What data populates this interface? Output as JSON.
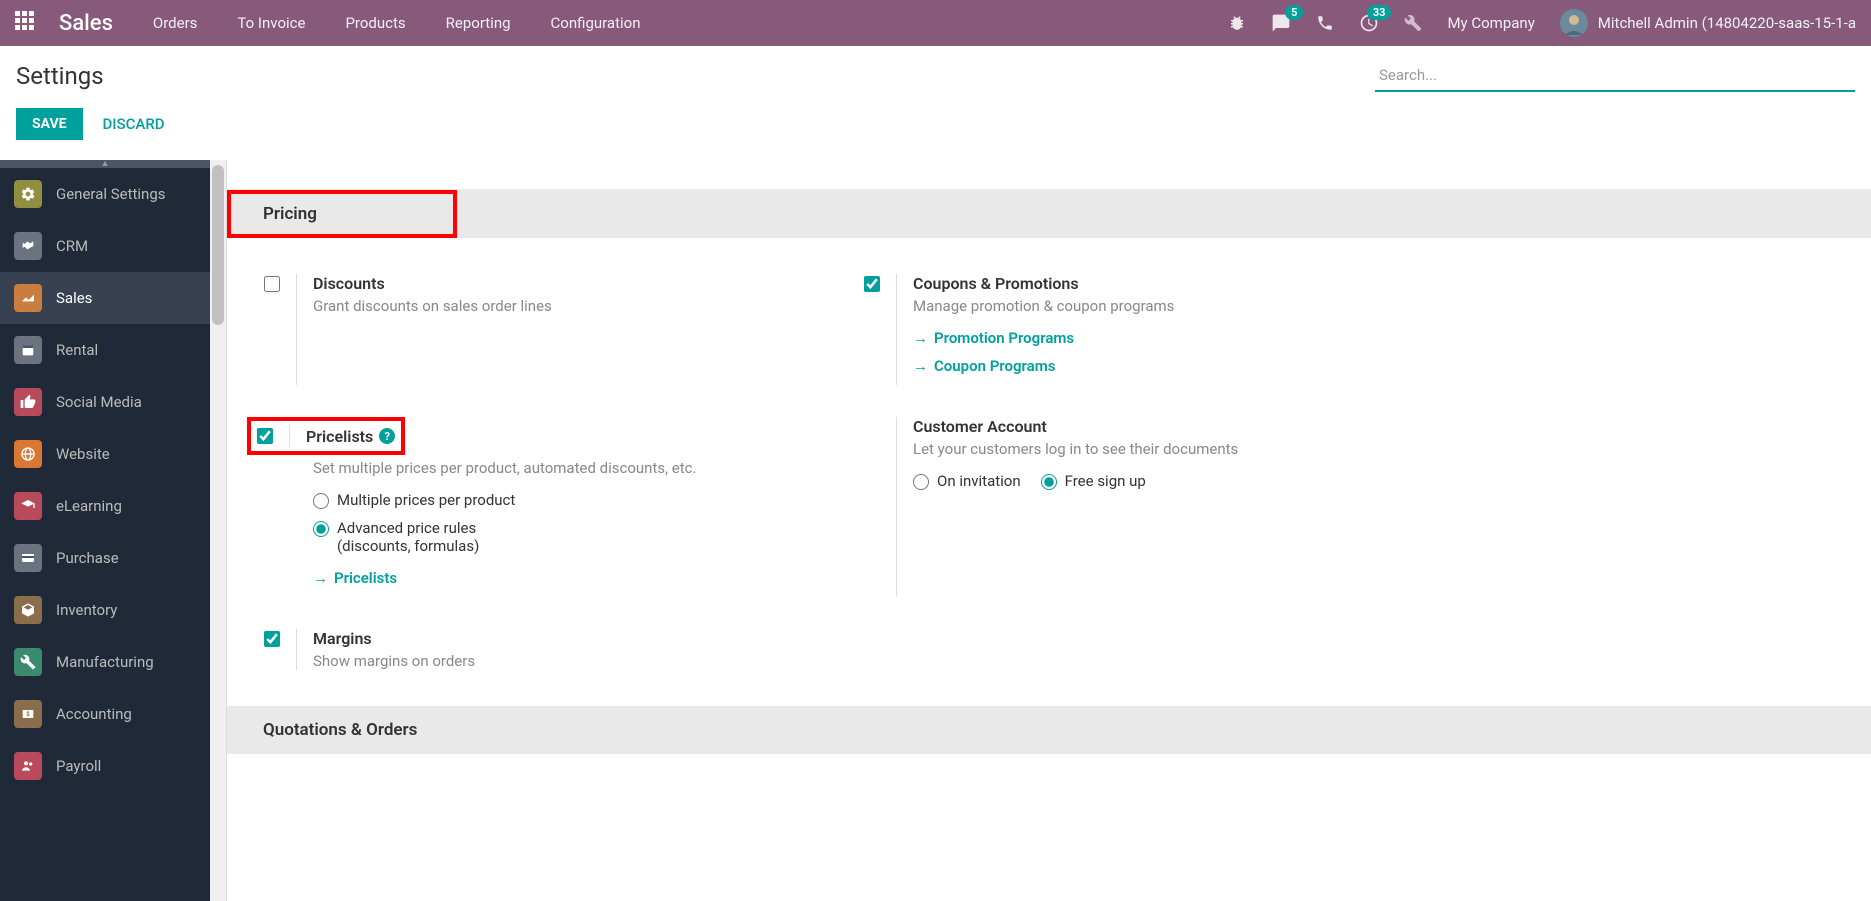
{
  "topbar": {
    "app_title": "Sales",
    "menu": [
      "Orders",
      "To Invoice",
      "Products",
      "Reporting",
      "Configuration"
    ],
    "msg_badge": "5",
    "activity_badge": "33",
    "company": "My Company",
    "user": "Mitchell Admin (14804220-saas-15-1-a"
  },
  "page": {
    "title": "Settings",
    "search_placeholder": "Search...",
    "save": "SAVE",
    "discard": "DISCARD"
  },
  "sidebar": {
    "items": [
      {
        "label": "General Settings",
        "color": "#8f8f3f"
      },
      {
        "label": "CRM",
        "color": "#6b7280"
      },
      {
        "label": "Sales",
        "color": "#c97d3f"
      },
      {
        "label": "Rental",
        "color": "#6b7280"
      },
      {
        "label": "Social Media",
        "color": "#b84a5c"
      },
      {
        "label": "Website",
        "color": "#d97733"
      },
      {
        "label": "eLearning",
        "color": "#b84a5c"
      },
      {
        "label": "Purchase",
        "color": "#6b7280"
      },
      {
        "label": "Inventory",
        "color": "#8a6d4a"
      },
      {
        "label": "Manufacturing",
        "color": "#3a8a6d"
      },
      {
        "label": "Accounting",
        "color": "#8a6d4a"
      },
      {
        "label": "Payroll",
        "color": "#b84a5c"
      }
    ]
  },
  "sections": {
    "pricing": {
      "title": "Pricing",
      "discounts": {
        "title": "Discounts",
        "desc": "Grant discounts on sales order lines"
      },
      "coupons": {
        "title": "Coupons & Promotions",
        "desc": "Manage promotion & coupon programs",
        "link1": "Promotion Programs",
        "link2": "Coupon Programs"
      },
      "pricelists": {
        "title": "Pricelists",
        "desc": "Set multiple prices per product, automated discounts, etc.",
        "opt1": "Multiple prices per product",
        "opt2a": "Advanced price rules",
        "opt2b": "(discounts, formulas)",
        "link": "Pricelists"
      },
      "customer_account": {
        "title": "Customer Account",
        "desc": "Let your customers log in to see their documents",
        "opt1": "On invitation",
        "opt2": "Free sign up"
      },
      "margins": {
        "title": "Margins",
        "desc": "Show margins on orders"
      }
    },
    "quotations": {
      "title": "Quotations & Orders"
    }
  }
}
